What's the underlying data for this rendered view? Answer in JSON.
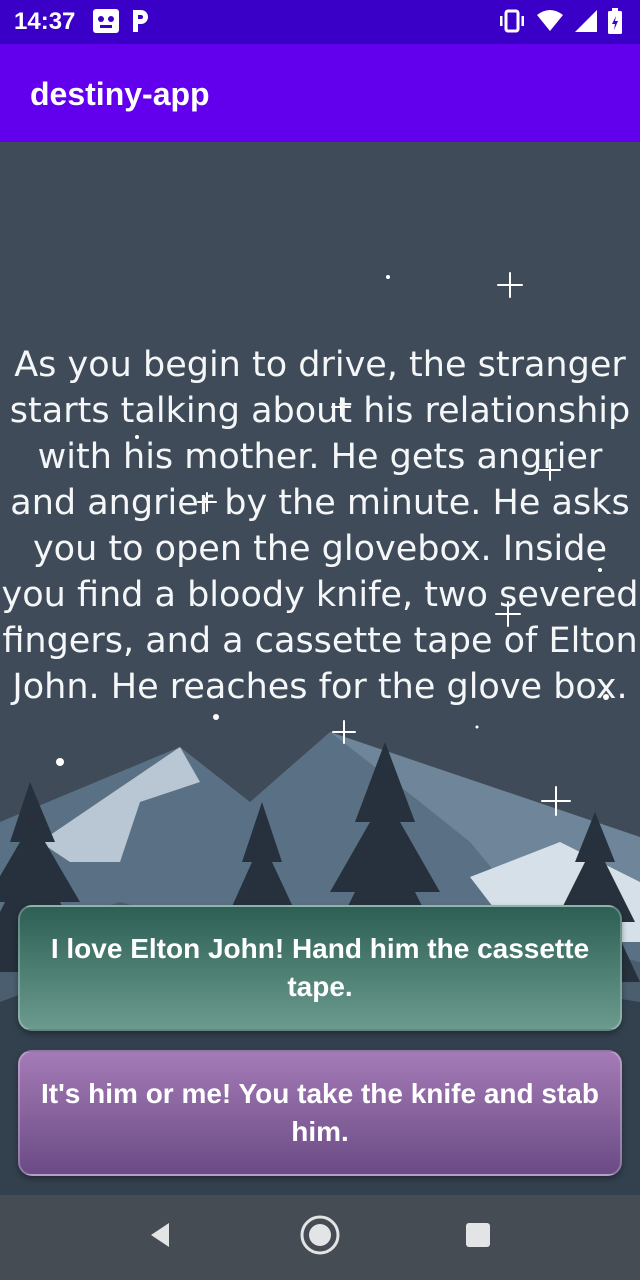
{
  "status_bar": {
    "time": "14:37",
    "left_icons": [
      "notification-app-icon",
      "p-icon"
    ],
    "right_icons": [
      "vibrate-icon",
      "wifi-icon",
      "signal-icon",
      "battery-icon"
    ]
  },
  "app_bar": {
    "title": "destiny-app"
  },
  "story": {
    "text": "As you begin to drive, the stranger starts talking about his relationship with his mother. He gets angrier and angrier by the minute. He asks you to open the glovebox. Inside you find a bloody knife, two severed fingers, and a cassette tape of Elton John. He reaches for the glove box."
  },
  "choices": [
    {
      "label": "I love Elton John! Hand him the cassette tape."
    },
    {
      "label": "It's him or me! You take the knife and stab him."
    }
  ],
  "nav_bar": {
    "icons": [
      "back-icon",
      "home-icon",
      "recents-icon"
    ]
  },
  "colors": {
    "status_bar": "#3a00c8",
    "app_bar": "#6200ee",
    "background": "#3f4b58",
    "choice_1": "#4f8074",
    "choice_2": "#8a66a0",
    "nav_bar": "#454c53"
  }
}
